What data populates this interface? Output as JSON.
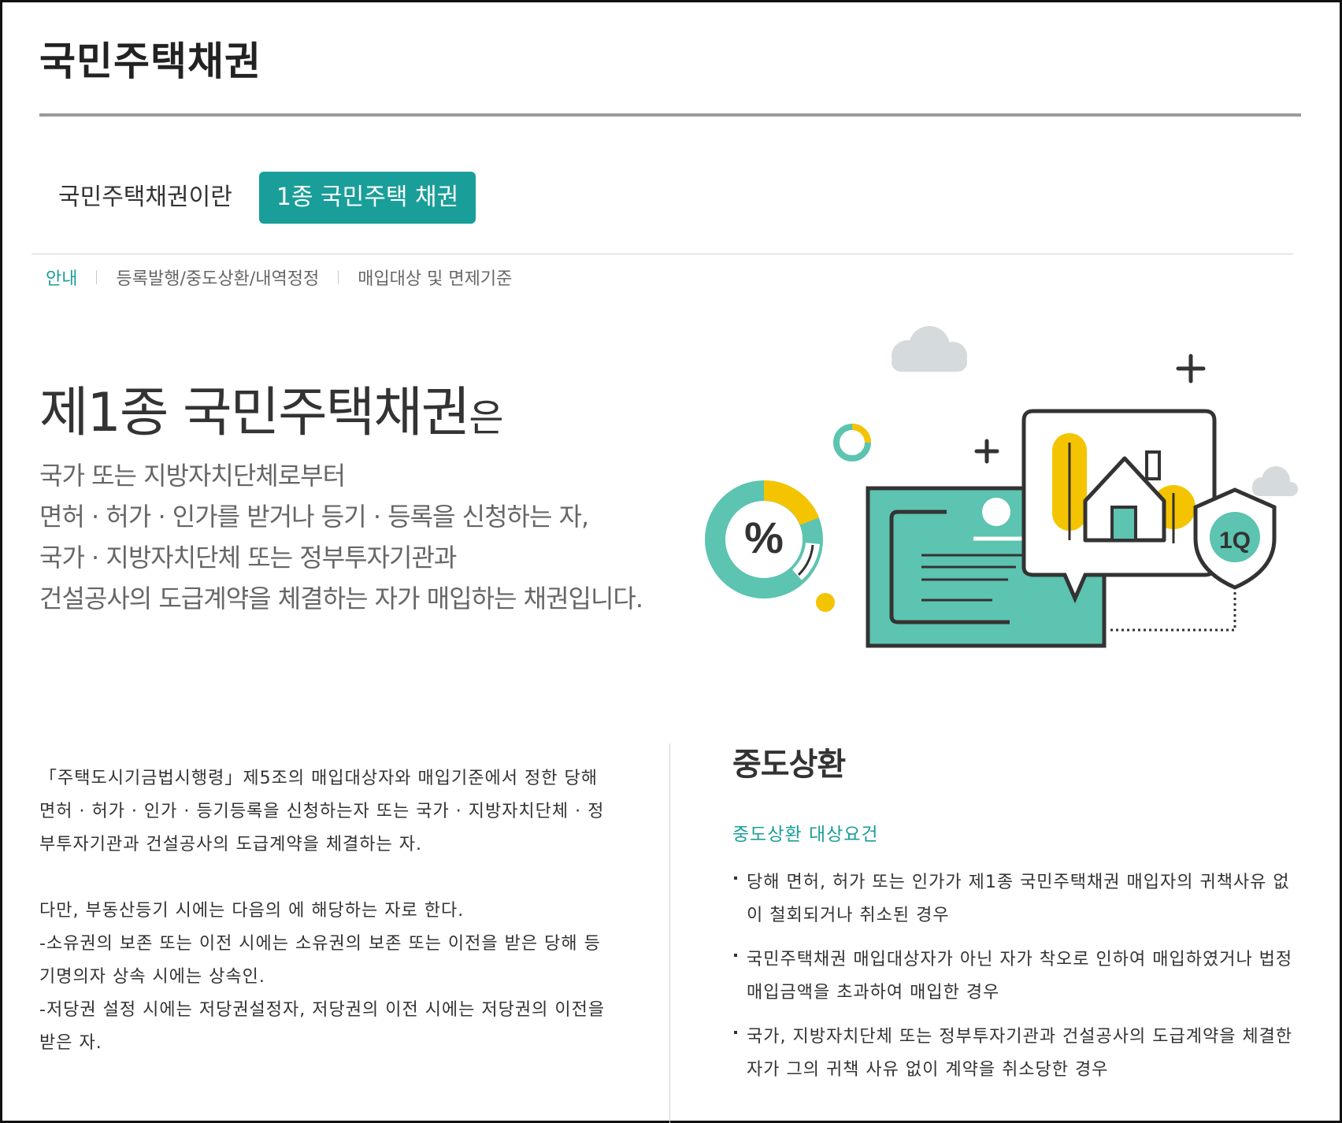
{
  "header": {
    "title": "국민주택채권"
  },
  "tabs": [
    {
      "label": "국민주택채권이란",
      "active": false
    },
    {
      "label": "1종 국민주택 채권",
      "active": true
    }
  ],
  "subnav": [
    {
      "label": "안내",
      "active": true
    },
    {
      "label": "등록발행/중도상환/내역정정",
      "active": false
    },
    {
      "label": "매입대상 및 면제기준",
      "active": false
    }
  ],
  "hero": {
    "heading": "제1종 국민주택채권",
    "heading_suffix": "은",
    "lines": [
      "국가 또는 지방자치단체로부터",
      "면허 · 허가 · 인가를 받거나 등기 · 등록을 신청하는 자,",
      "국가 · 지방자치단체 또는 정부투자기관과",
      "건설공사의 도급계약을 체결하는 자가 매입하는 채권입니다."
    ]
  },
  "illustration": {
    "percent_symbol": "%",
    "shield_text": "1Q",
    "colors": {
      "teal": "#5cc4b0",
      "yellow": "#f5c400",
      "cloud": "#d5dadc",
      "line": "#333333"
    }
  },
  "left_column": {
    "paragraph1": "「주택도시기금법시행령」제5조의 매입대상자와 매입기준에서 정한 당해 면허 · 허가 · 인가 · 등기등록을 신청하는자 또는 국가 · 지방자치단체 · 정부투자기관과 건설공사의 도급계약을 체결하는 자.",
    "paragraph2_intro": "다만, 부동산등기 시에는 다음의 에 해당하는 자로 한다.",
    "paragraph2_item1": "-소유권의 보존 또는 이전 시에는 소유권의 보존 또는 이전을 받은 당해 등기명의자 상속 시에는 상속인.",
    "paragraph2_item2": "-저당권 설정 시에는 저당권설정자, 저당권의 이전 시에는 저당권의 이전을 받은 자."
  },
  "right_column": {
    "title": "중도상환",
    "subtitle": "중도상환 대상요건",
    "items": [
      "당해 면허, 허가 또는 인가가 제1종 국민주택채권 매입자의 귀책사유 없이 철회되거나 취소된 경우",
      "국민주택채권 매입대상자가 아닌 자가 착오로 인하여 매입하였거나 법정매입금액을 초과하여 매입한 경우",
      "국가, 지방자치단체 또는 정부투자기관과 건설공사의 도급계약을 체결한 자가 그의 귀책 사유 없이 계약을 취소당한 경우"
    ]
  }
}
